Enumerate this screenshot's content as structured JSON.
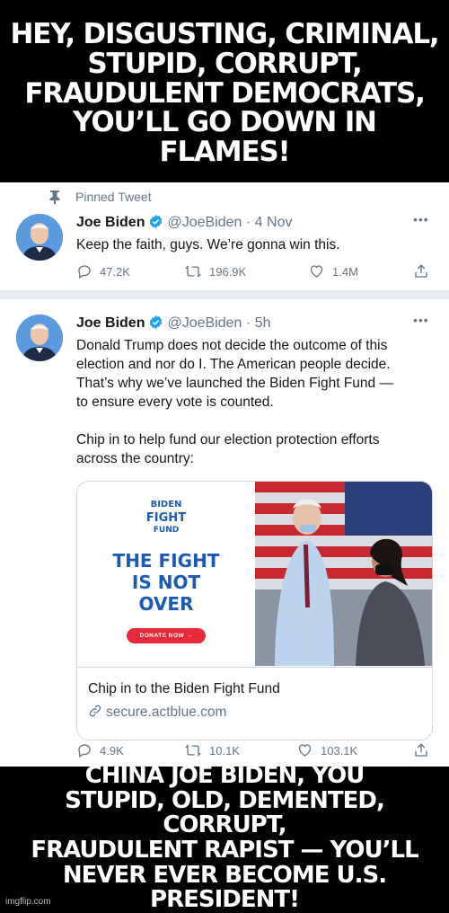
{
  "meme": {
    "top_caption": [
      "HEY, DISGUSTING, CRIMINAL,",
      "STUPID, CORRUPT,",
      "FRAUDULENT DEMOCRATS,",
      "YOU’LL GO DOWN IN FLAMES!"
    ],
    "bottom_caption": [
      "CHINA JOE BIDEN, YOU",
      "STUPID, OLD, DEMENTED, CORRUPT,",
      "FRAUDULENT RAPIST — YOU’LL",
      "NEVER EVER BECOME U.S. PRESIDENT!"
    ],
    "watermark": "imgflip.com"
  },
  "pinned_label": "Pinned Tweet",
  "tweets": [
    {
      "name": "Joe Biden",
      "handle": "@JoeBiden",
      "time": "· 4 Nov",
      "text": "Keep the faith, guys. We’re gonna win this.",
      "replies": "47.2K",
      "retweets": "196.9K",
      "likes": "1.4M"
    },
    {
      "name": "Joe Biden",
      "handle": "@JoeBiden",
      "time": "· 5h",
      "text_lines": [
        "Donald Trump does not decide the outcome of this",
        "election and nor do I. The American people decide.",
        "That’s why we’ve launched the Biden Fight Fund —",
        "to ensure every vote is counted.",
        "",
        "Chip in to help fund our election protection efforts",
        "across the country:"
      ],
      "card": {
        "small_lines": [
          "BIDEN",
          "FIGHT",
          "FUND"
        ],
        "big_lines": [
          "THE FIGHT",
          "IS NOT",
          "OVER"
        ],
        "donate_label": "DONATE NOW →",
        "title": "Chip in to the Biden Fight Fund",
        "url": "secure.actblue.com"
      },
      "replies": "4.9K",
      "retweets": "10.1K",
      "likes": "103.1K"
    }
  ],
  "colors": {
    "verified": "#1da1f2",
    "secondary_text": "#657786",
    "brand_blue": "#1b5bb5",
    "donate_red": "#e8293b"
  },
  "icons": [
    "pin-icon",
    "verified-badge-icon",
    "more-icon",
    "reply-icon",
    "retweet-icon",
    "like-icon",
    "share-icon",
    "link-icon"
  ]
}
